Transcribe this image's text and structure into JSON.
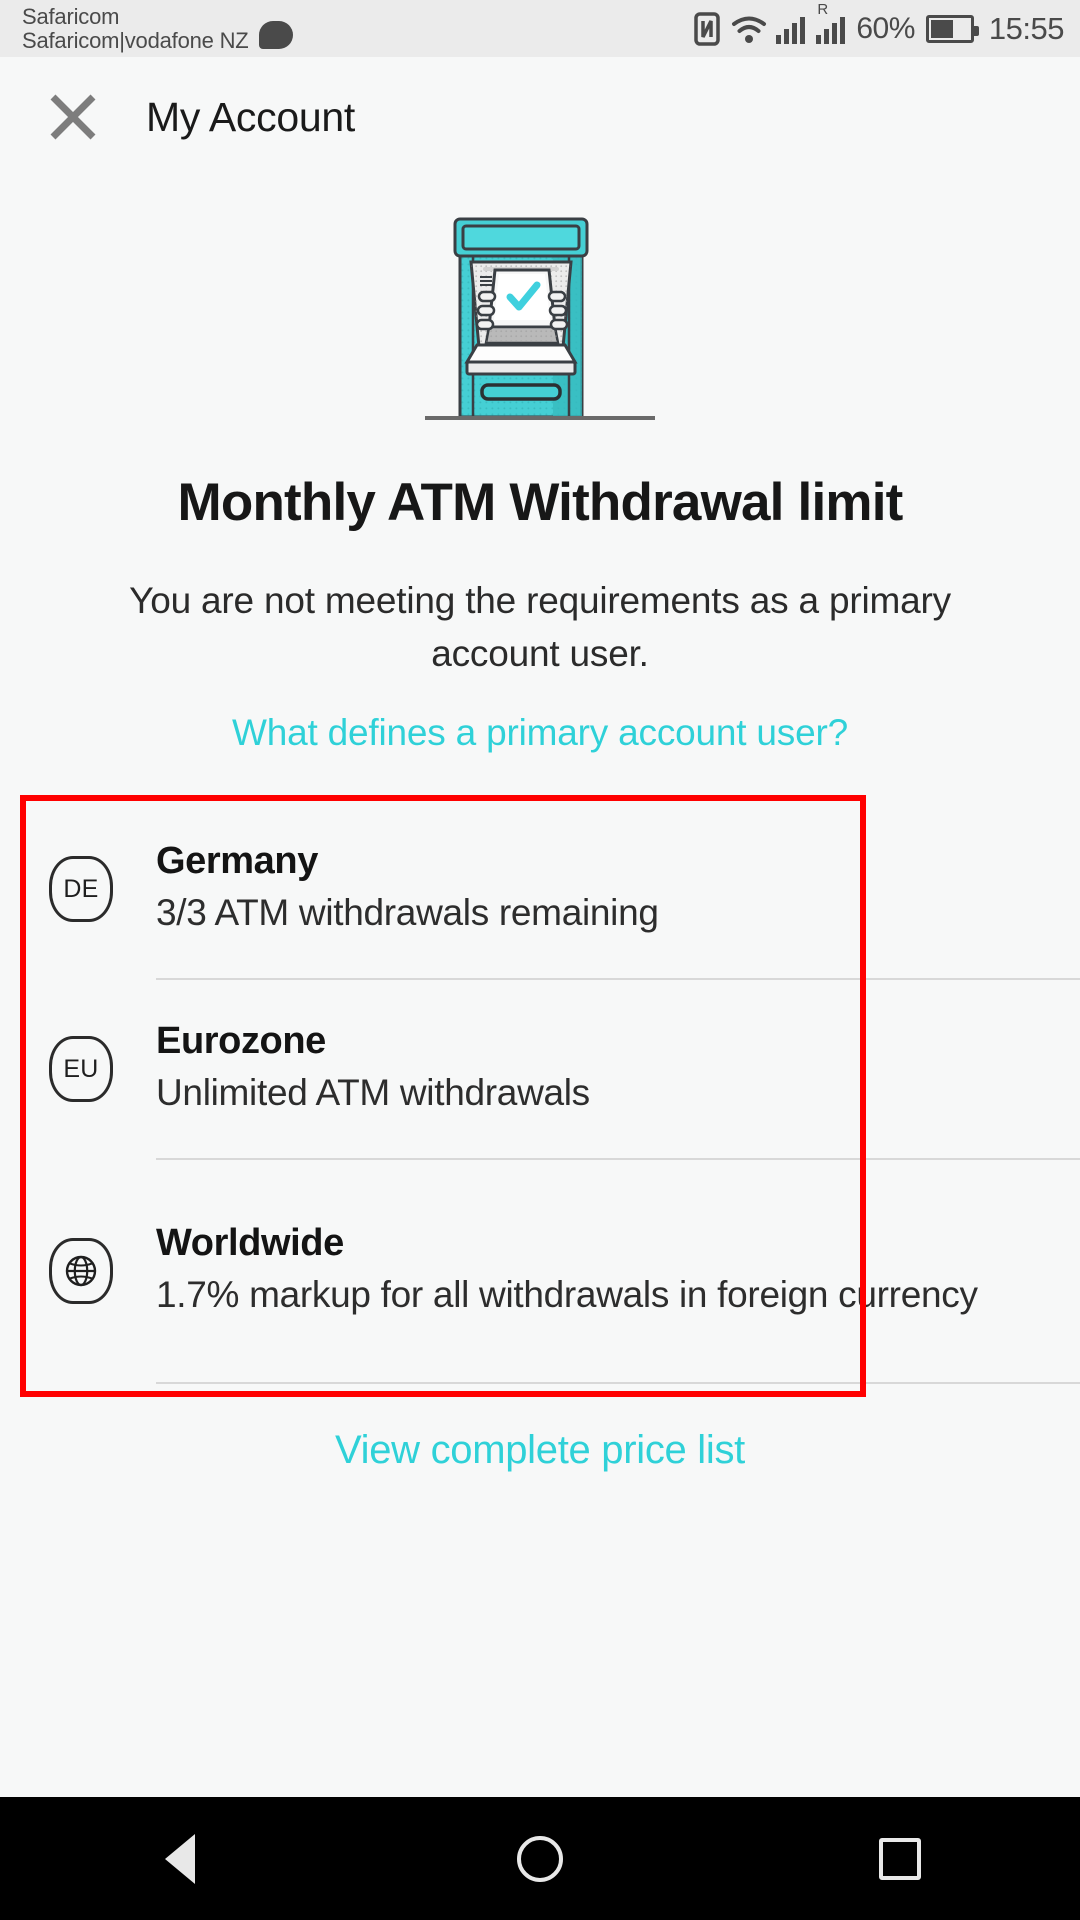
{
  "statusbar": {
    "carrier_line1": "Safaricom",
    "carrier_line2": "Safaricom|vodafone NZ",
    "message_icon": "message-bubble-icon",
    "nfc_icon": "nfc-icon",
    "wifi_icon": "wifi-icon",
    "signal_icon": "signal-bars-icon",
    "roaming_label": "R",
    "battery_percent": "60%",
    "battery_icon": "battery-icon",
    "clock": "15:55"
  },
  "header": {
    "close_icon": "close-icon",
    "title": "My Account"
  },
  "illustration": {
    "name": "atm-machine-illustration",
    "check_color": "#3fd0de",
    "body_color": "#45cfd4"
  },
  "main": {
    "title": "Monthly ATM Withdrawal limit",
    "subtitle": "You are not meeting the requirements as a primary account user.",
    "primary_link": "What defines a primary account user?",
    "bottom_link": "View complete price list",
    "link_color": "#2fd1d8"
  },
  "limits": [
    {
      "icon": "flag-de-icon",
      "icon_label": "DE",
      "title": "Germany",
      "desc": "3/3 ATM withdrawals remaining"
    },
    {
      "icon": "flag-eu-icon",
      "icon_label": "EU",
      "title": "Eurozone",
      "desc": "Unlimited ATM withdrawals"
    },
    {
      "icon": "globe-icon",
      "icon_label": "",
      "title": "Worldwide",
      "desc": "1.7% markup for all withdrawals in foreign currency"
    }
  ],
  "annotation": {
    "name": "red-highlight-box",
    "color": "#ff0000"
  },
  "navbar": {
    "back_icon": "back-triangle-icon",
    "home_icon": "home-circle-icon",
    "recents_icon": "recents-square-icon"
  }
}
